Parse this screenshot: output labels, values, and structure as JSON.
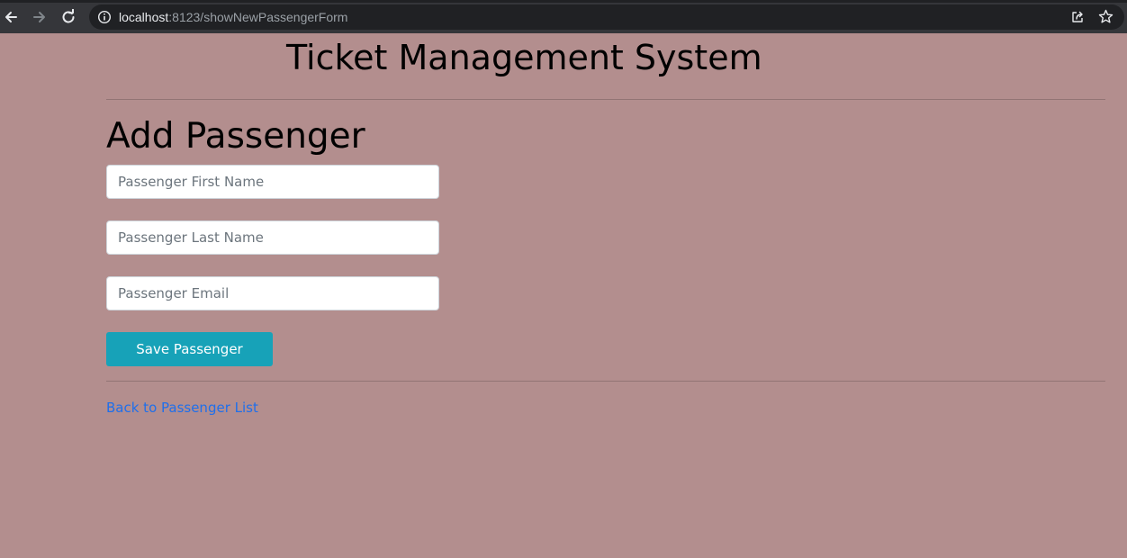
{
  "browser": {
    "url_host": "localhost",
    "url_rest": ":8123/showNewPassengerForm",
    "icons": {
      "back": "arrow-left-icon",
      "forward": "arrow-right-icon",
      "reload": "reload-icon",
      "info": "info-icon",
      "share": "share-icon",
      "bookmark": "star-icon"
    }
  },
  "header": {
    "site_title": "Ticket Management System"
  },
  "form": {
    "title": "Add Passenger",
    "first_name": {
      "placeholder": "Passenger First Name",
      "value": ""
    },
    "last_name": {
      "placeholder": "Passenger Last Name",
      "value": ""
    },
    "email": {
      "placeholder": "Passenger Email",
      "value": ""
    },
    "save_label": "Save Passenger"
  },
  "footer": {
    "back_link_label": "Back to Passenger List"
  },
  "colors": {
    "page_background": "#b38e8e",
    "button_background": "#17a2b8",
    "link": "#1f6feb",
    "browser_toolbar": "#35363a"
  }
}
